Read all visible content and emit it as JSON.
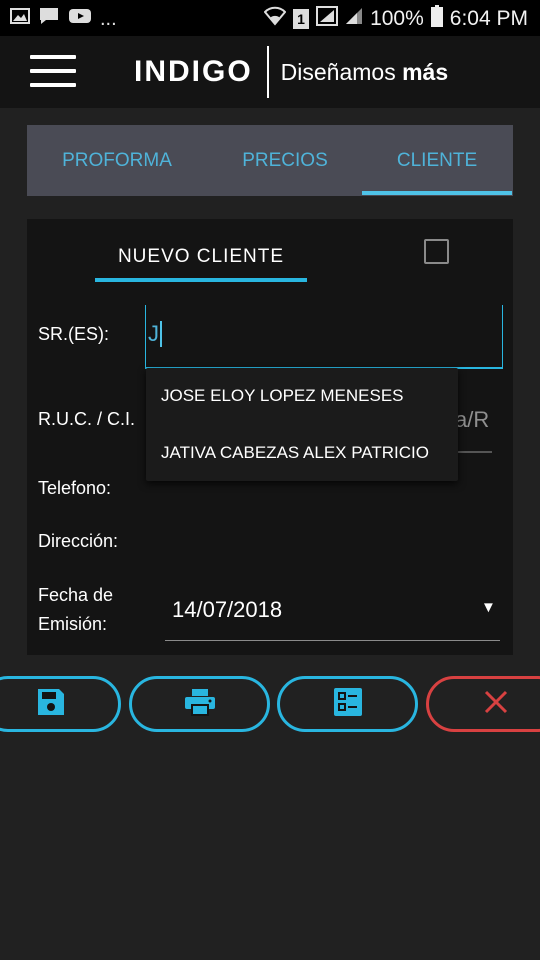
{
  "status_bar": {
    "left_icons": [
      "image-icon",
      "chat-bubble-icon",
      "youtube-icon"
    ],
    "ellipsis": "...",
    "sim_slot": "1",
    "battery": "100%",
    "time": "6:04 PM"
  },
  "app_bar": {
    "logo_text": "INDIGO",
    "tagline_prefix": "Diseñamos ",
    "tagline_bold": "más"
  },
  "tabs": [
    {
      "label": "PROFORMA",
      "active": false
    },
    {
      "label": "PRECIOS",
      "active": false
    },
    {
      "label": "CLIENTE",
      "active": true
    }
  ],
  "form": {
    "nuevo_cliente": "NUEVO CLIENTE",
    "sr_label": "SR.(ES):",
    "sr_value": "J",
    "ruc_label": "R.U.C. / C.I.",
    "ruc_hint_partial": "a/R",
    "telefono_label": "Telefono:",
    "direccion_label": "Dirección:",
    "fecha_label_line1": "Fecha de",
    "fecha_label_line2": "Emisión:",
    "fecha_value": "14/07/2018"
  },
  "autocomplete": [
    "JOSE ELOY LOPEZ MENESES",
    "JATIVA CABEZAS ALEX PATRICIO"
  ],
  "actions": [
    "save-icon",
    "print-icon",
    "checklist-icon",
    "close-icon"
  ],
  "colors": {
    "accent": "#29b6e0",
    "tab_text": "#4fb3d9",
    "cancel": "#d84141",
    "background": "#212121"
  }
}
